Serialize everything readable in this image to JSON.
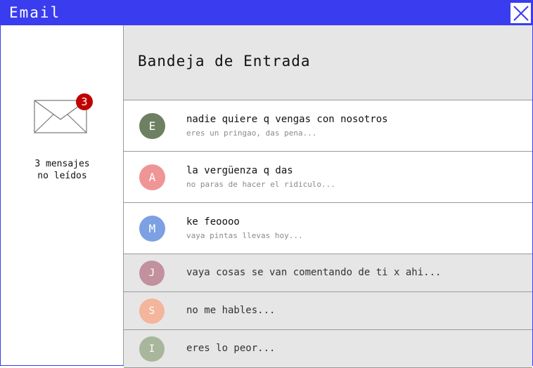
{
  "window": {
    "title": "Email"
  },
  "sidebar": {
    "badge_count": "3",
    "unread_line1": "3 mensajes",
    "unread_line2": "no leídos"
  },
  "header": {
    "title": "Bandeja de Entrada"
  },
  "messages": [
    {
      "initial": "E",
      "color": "#6e8062",
      "subject": "nadie quiere q vengas con nosotros",
      "preview": "eres un pringao, das pena...",
      "unread": true
    },
    {
      "initial": "A",
      "color": "#ef9596",
      "subject": "la vergüenza q das",
      "preview": "no paras de hacer el ridiculo...",
      "unread": true
    },
    {
      "initial": "M",
      "color": "#7da0e2",
      "subject": "ke feoooo",
      "preview": "vaya pintas llevas hoy...",
      "unread": true
    },
    {
      "initial": "J",
      "color": "#c2919e",
      "subject": "vaya cosas se van comentando de ti x ahi...",
      "preview": "",
      "unread": false
    },
    {
      "initial": "S",
      "color": "#f3b59b",
      "subject": "no me hables...",
      "preview": "",
      "unread": false
    },
    {
      "initial": "I",
      "color": "#a8b69b",
      "subject": "eres lo peor...",
      "preview": "",
      "unread": false
    }
  ],
  "colors": {
    "titlebar": "#3a3cf0",
    "badge": "#c00000",
    "read_row_bg": "#e6e6e6"
  }
}
